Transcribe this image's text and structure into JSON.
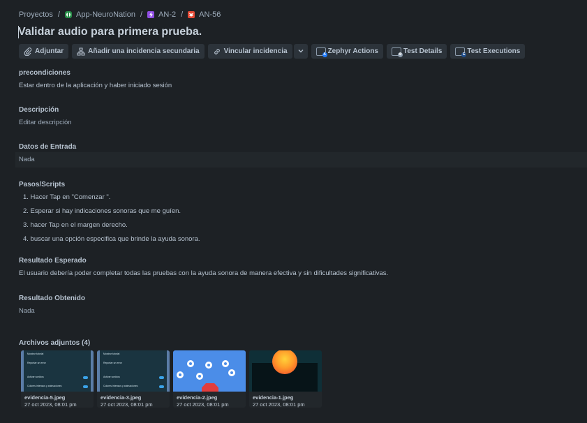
{
  "breadcrumb": [
    {
      "label": "Proyectos",
      "icon": ""
    },
    {
      "label": "App-NeuroNation",
      "icon": "project-icon"
    },
    {
      "label": "AN-2",
      "icon": "epic-icon"
    },
    {
      "label": "AN-56",
      "icon": "bug-icon"
    }
  ],
  "issue": {
    "title": "Validar audio para primera prueba."
  },
  "toolbar": {
    "attach": "Adjuntar",
    "add_child": "Añadir una incidencia secundaria",
    "link": "Vincular incidencia",
    "zephyr": "Zephyr Actions",
    "test_details": "Test Details",
    "test_executions": "Test Executions"
  },
  "fields": {
    "preconditions": {
      "label": "precondiciones",
      "value": "Estar dentro de la aplicación y haber iniciado sesión"
    },
    "description": {
      "label": "Descripción",
      "value": "Editar descripción"
    },
    "input_data": {
      "label": "Datos de Entrada",
      "value": "Nada"
    },
    "steps": {
      "label": "Pasos/Scripts",
      "items": [
        "1. Hacer Tap en \"Comenzar \".",
        "2.  Esperar  si hay indicaciones sonoras que me guíen.",
        "3.  hacer Tap en el margen derecho.",
        "4. buscar  una opción especifica que brinde la ayuda sonora."
      ]
    },
    "expected": {
      "label": "Resultado Esperado",
      "value": "El usuario debería poder completar todas las pruebas con la ayuda sonora de manera efectiva y sin dificultades significativas."
    },
    "obtained": {
      "label": "Resultado Obtenido",
      "value": "Nada"
    }
  },
  "attachments": {
    "label": "Archivos adjuntos (4)",
    "items": [
      {
        "name": "evidencia-5.jpeg",
        "date": "27 oct 2023, 08:01 pm"
      },
      {
        "name": "evidencia-3.jpeg",
        "date": "27 oct 2023, 08:01 pm"
      },
      {
        "name": "evidencia-2.jpeg",
        "date": "27 oct 2023, 08:01 pm"
      },
      {
        "name": "evidencia-1.jpeg",
        "date": "27 oct 2023, 08:01 pm"
      }
    ],
    "thumb_menu": {
      "item1": "Mostrar tutorial",
      "item2": "Reportar un error",
      "item3": "Activar sonidos",
      "item4": "Colores intensos y animaciones"
    }
  },
  "colors": {
    "background": "#1d2125",
    "button": "#2c333a",
    "text": "#b6c2cf"
  }
}
